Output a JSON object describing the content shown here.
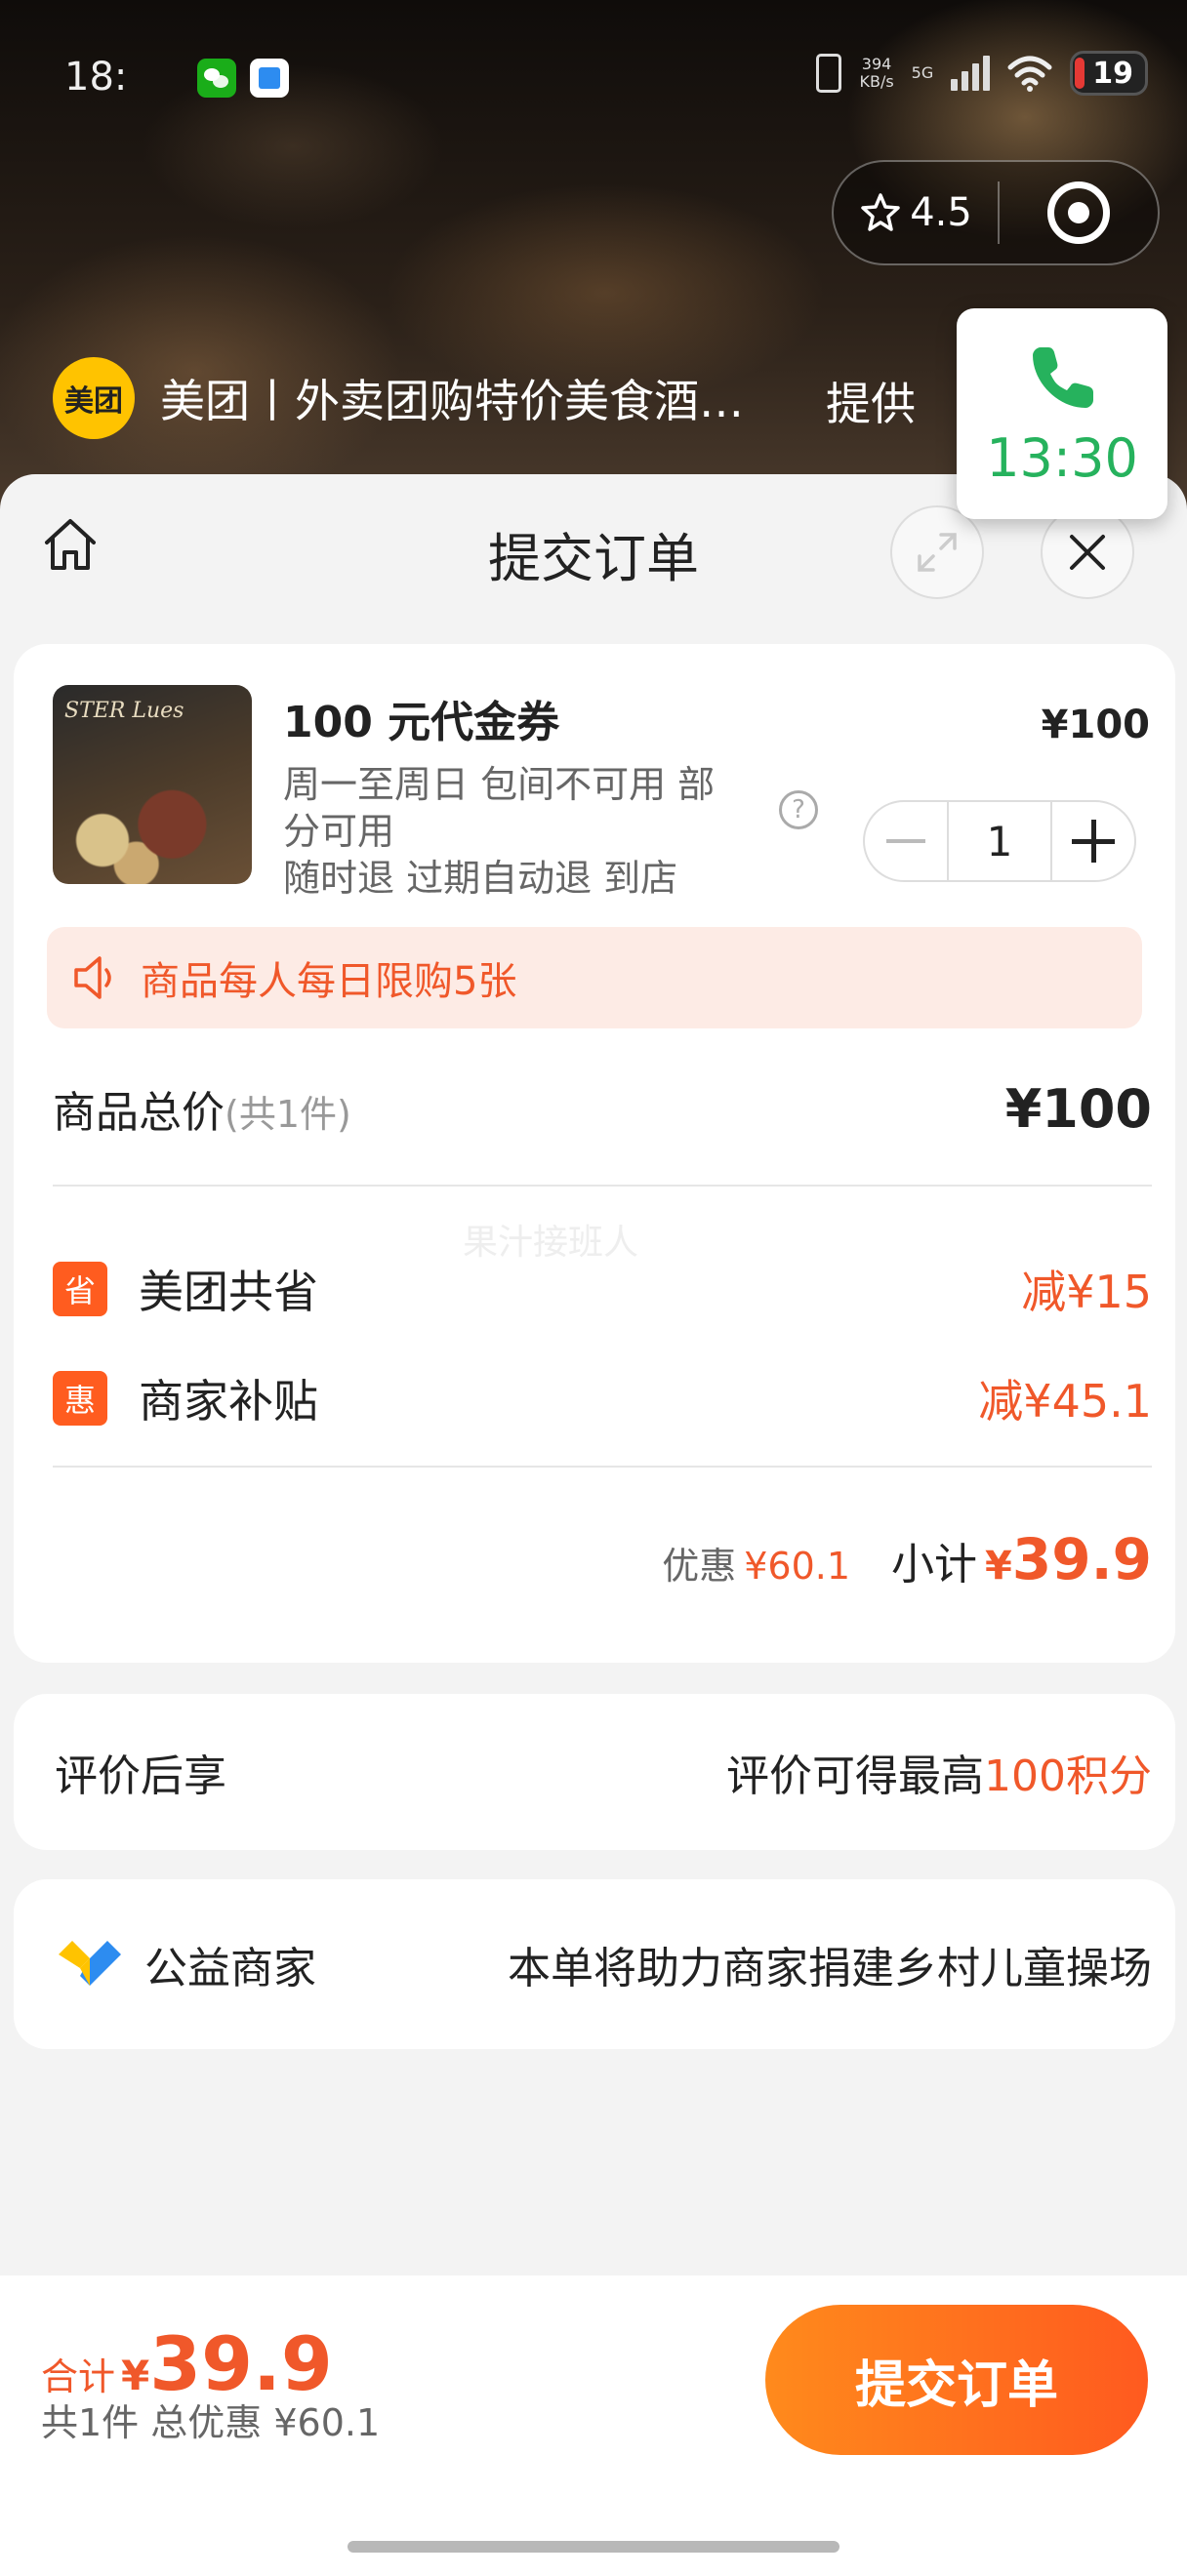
{
  "status_bar": {
    "time": "18:",
    "speed_top": "394",
    "speed_bottom": "KB/s",
    "network": "5G",
    "battery": "19"
  },
  "capsule": {
    "rating": "4.5"
  },
  "source": {
    "logo_text": "美团",
    "title": "美团丨外卖团购特价美食酒…",
    "extra": "提供"
  },
  "call": {
    "time": "13:30"
  },
  "sheet": {
    "title": "提交订单"
  },
  "product": {
    "name": "100 元代金券",
    "price": "¥100",
    "image_text": "STER Lues",
    "desc_line1": "周一至周日 包间不可用 部",
    "desc_line2": "分可用",
    "desc_line3": "随时退 过期自动退 到店",
    "quantity": "1"
  },
  "limit_notice": "商品每人每日限购5张",
  "total": {
    "label": "商品总价",
    "count": "(共1件)",
    "value": "¥100"
  },
  "watermark": "果汁接班人",
  "discounts": [
    {
      "badge": "省",
      "label": "美团共省",
      "value": "减¥15"
    },
    {
      "badge": "惠",
      "label": "商家补贴",
      "value": "减¥45.1"
    }
  ],
  "subtotal": {
    "saving_label": "优惠",
    "saving_value": "¥60.1",
    "label": "小计",
    "currency": "¥",
    "value": "39.9"
  },
  "review": {
    "label": "评价后享",
    "prefix": "评价可得最高",
    "points": "100积分"
  },
  "charity": {
    "label": "公益商家",
    "desc": "本单将助力商家捐建乡村儿童操场"
  },
  "bottom": {
    "total_label": "合计",
    "currency": "¥",
    "total_value": "39.9",
    "summary": "共1件 总优惠 ¥60.1",
    "submit_label": "提交订单"
  },
  "colors": {
    "accent": "#f0582a",
    "brand_yellow": "#ffc300",
    "call_green": "#26b25d"
  }
}
